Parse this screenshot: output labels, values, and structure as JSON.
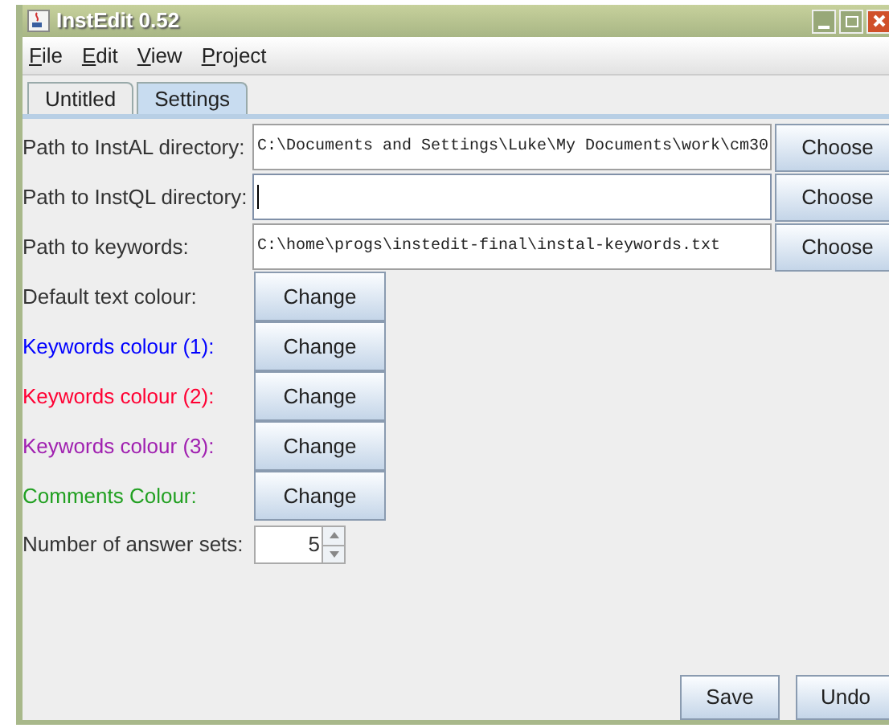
{
  "window": {
    "title": "InstEdit 0.52"
  },
  "menu": [
    "File",
    "Edit",
    "View",
    "Project"
  ],
  "tabs": [
    {
      "label": "Untitled",
      "selected": false
    },
    {
      "label": "Settings",
      "selected": true
    }
  ],
  "paths": [
    {
      "label": "Path to InstAL directory:",
      "value": "C:\\Documents and Settings\\Luke\\My Documents\\work\\cm30",
      "focused": false,
      "button": "Choose"
    },
    {
      "label": "Path to InstQL directory:",
      "focused": true,
      "button": "Choose"
    },
    {
      "label": "Path to keywords:",
      "value": "C:\\home\\progs\\instedit-final\\instal-keywords.txt",
      "focused": false,
      "button": "Choose"
    }
  ],
  "colours": [
    {
      "label": "Default text colour:",
      "color": "#333333",
      "button": "Change"
    },
    {
      "label": "Keywords colour (1):",
      "color": "#0000ff",
      "button": "Change"
    },
    {
      "label": "Keywords colour (2):",
      "color": "#ff0033",
      "button": "Change"
    },
    {
      "label": "Keywords colour (3):",
      "color": "#a020b0",
      "button": "Change"
    },
    {
      "label": "Comments Colour:",
      "color": "#22a022",
      "button": "Change"
    }
  ],
  "answer_sets": {
    "label": "Number of answer sets:",
    "value": "5"
  },
  "buttons": [
    "Save",
    "Undo"
  ]
}
